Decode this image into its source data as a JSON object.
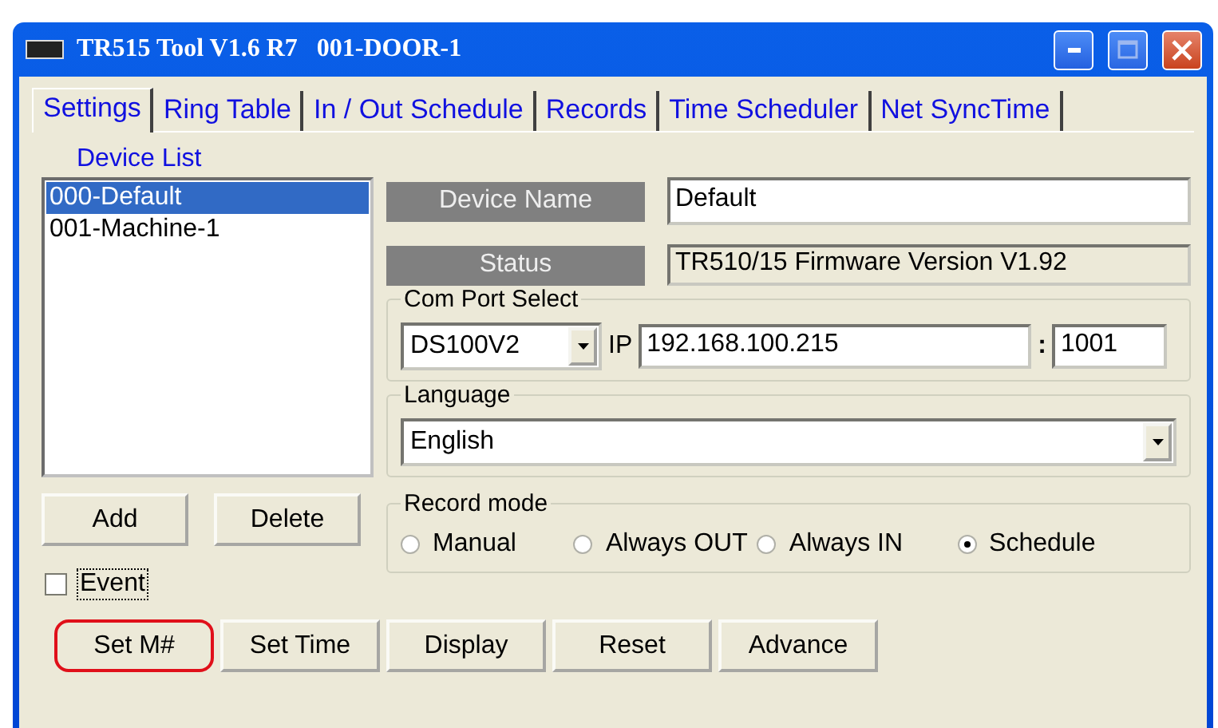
{
  "window": {
    "title": "TR515 Tool V1.6 R7   001-DOOR-1"
  },
  "tabs": [
    {
      "label": "Settings",
      "selected": true
    },
    {
      "label": "Ring Table",
      "selected": false
    },
    {
      "label": "In / Out Schedule",
      "selected": false
    },
    {
      "label": "Records",
      "selected": false
    },
    {
      "label": "Time Scheduler",
      "selected": false
    },
    {
      "label": "Net SyncTime",
      "selected": false
    }
  ],
  "device_list": {
    "label": "Device List",
    "items": [
      {
        "label": "000-Default",
        "selected": true
      },
      {
        "label": "001-Machine-1",
        "selected": false
      }
    ]
  },
  "device_name": {
    "label": "Device Name",
    "value": "Default"
  },
  "status": {
    "label": "Status",
    "value": "TR510/15 Firmware Version V1.92"
  },
  "com_port": {
    "title": "Com Port Select",
    "port": "DS100V2",
    "ip_label": "IP",
    "ip": "192.168.100.215",
    "separator": ":",
    "port_number": "1001"
  },
  "language": {
    "title": "Language",
    "value": "English"
  },
  "list_buttons": [
    "Add",
    "Delete"
  ],
  "event": {
    "label": "Event",
    "checked": false
  },
  "record_mode": {
    "title": "Record mode",
    "options": [
      {
        "label": "Manual",
        "selected": false
      },
      {
        "label": "Always OUT",
        "selected": false
      },
      {
        "label": "Always IN",
        "selected": false
      },
      {
        "label": "Schedule",
        "selected": true
      }
    ]
  },
  "buttons": [
    {
      "label": "Set M#",
      "highlighted": true
    },
    {
      "label": "Set Time",
      "highlighted": false
    },
    {
      "label": "Display",
      "highlighted": false
    },
    {
      "label": "Reset",
      "highlighted": false
    },
    {
      "label": "Advance",
      "highlighted": false
    }
  ]
}
